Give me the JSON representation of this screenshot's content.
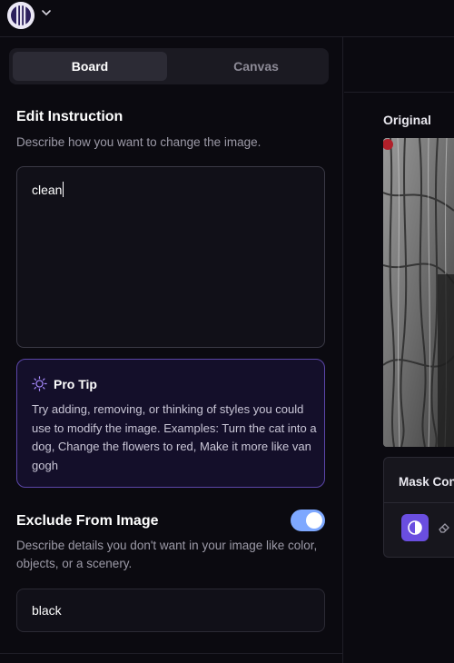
{
  "tabs": [
    {
      "label": "Board",
      "active": true
    },
    {
      "label": "Canvas",
      "active": false
    }
  ],
  "edit": {
    "title": "Edit Instruction",
    "description": "Describe how you want to change the image.",
    "value": "clean"
  },
  "tip": {
    "title": "Pro Tip",
    "body": "Try adding, removing, or thinking of styles you could use to modify the image. Examples: Turn the cat into a dog, Change the flowers to red, Make it more like van gogh",
    "icon": "lightbulb-icon"
  },
  "exclude": {
    "title": "Exclude From Image",
    "description": "Describe details you don't want in your image like color, objects, or a scenery.",
    "value": "black",
    "toggle_on": true
  },
  "preview": {
    "original_label": "Original",
    "mask_title": "Mask Con"
  },
  "colors": {
    "accent": "#6a4ee0",
    "toggle": "#7ea8ff",
    "tip_border": "#5b46a8"
  }
}
